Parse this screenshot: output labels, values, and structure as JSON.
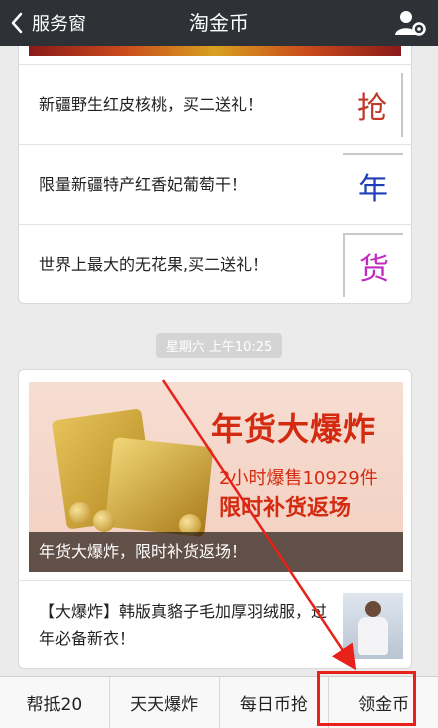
{
  "navbar": {
    "back_label": "服务窗",
    "title": "淘金币"
  },
  "promos": [
    {
      "text": "新疆野生红皮核桃，买二送礼！",
      "thumb_char": "抢",
      "thumb_color": "#c0392b"
    },
    {
      "text": "限量新疆特产红香妃葡萄干！",
      "thumb_char": "年",
      "thumb_color": "#1f3fb8"
    },
    {
      "text": "世界上最大的无花果,买二送礼！",
      "thumb_char": "货",
      "thumb_color": "#c02ac0"
    }
  ],
  "timestamp": "星期六 上午10:25",
  "banner": {
    "headline": "年货大爆炸",
    "line1": "2小时爆售10929件",
    "line2": "限时补货返场",
    "caption": "年货大爆炸，限时补货返场！"
  },
  "news": {
    "text": "【大爆炸】韩版真貉子毛加厚羽绒服，过年必备新衣！"
  },
  "bottom_tabs": [
    "帮抵20",
    "天天爆炸",
    "每日币抢",
    "领金币"
  ],
  "annotation_color": "#e8211a"
}
